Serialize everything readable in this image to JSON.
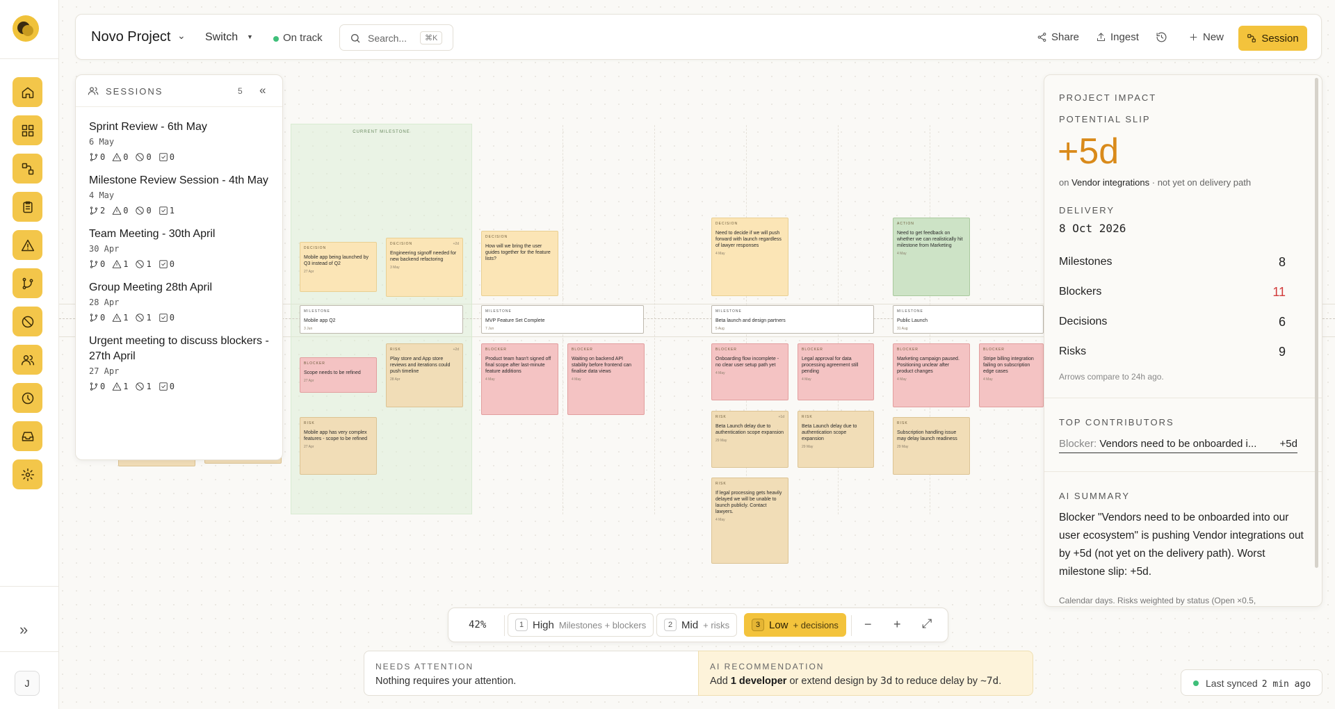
{
  "topbar": {
    "project_name": "Novo Project",
    "switch_label": "Switch",
    "status": "On track",
    "search_placeholder": "Search...",
    "search_shortcut": "⌘K",
    "share_label": "Share",
    "ingest_label": "Ingest",
    "new_label": "New",
    "session_label": "Session"
  },
  "rail": {
    "items": [
      "home",
      "dashboard",
      "workflow",
      "tasks",
      "alerts",
      "branches",
      "blocked",
      "people",
      "history",
      "inbox",
      "settings"
    ],
    "avatar_initial": "J"
  },
  "sessions": {
    "title": "SESSIONS",
    "count": "5",
    "items": [
      {
        "name": "Sprint Review - 6th May",
        "date": "6 May",
        "branches": "0",
        "risks": "0",
        "blockers": "0",
        "decisions": "0"
      },
      {
        "name": "Milestone Review Session - 4th May",
        "date": "4 May",
        "branches": "2",
        "risks": "0",
        "blockers": "0",
        "decisions": "1"
      },
      {
        "name": "Team Meeting - 30th April",
        "date": "30 Apr",
        "branches": "0",
        "risks": "1",
        "blockers": "1",
        "decisions": "0"
      },
      {
        "name": "Group Meeting 28th April",
        "date": "28 Apr",
        "branches": "0",
        "risks": "1",
        "blockers": "1",
        "decisions": "0"
      },
      {
        "name": "Urgent meeting to discuss blockers - 27th April",
        "date": "27 Apr",
        "branches": "0",
        "risks": "1",
        "blockers": "1",
        "decisions": "0"
      }
    ]
  },
  "canvas": {
    "current_milestone_label": "CURRENT MILESTONE",
    "cards": [
      {
        "type": "decision",
        "tag": "DECISION",
        "text": "Mobile app being launched by Q3 instead of Q2",
        "date": "27 Apr",
        "delta": ""
      },
      {
        "type": "decision",
        "tag": "DECISION",
        "text": "Engineering signoff needed for new backend refactoring",
        "date": "3 May",
        "delta": "+2d"
      },
      {
        "type": "milestone",
        "tag": "MILESTONE",
        "text": "Mobile app Q2",
        "date": "3 Jun",
        "delta": ""
      },
      {
        "type": "blocker",
        "tag": "BLOCKER",
        "text": "Scope needs to be refined",
        "date": "27 Apr",
        "delta": ""
      },
      {
        "type": "risk",
        "tag": "RISK",
        "text": "Play store and App store reviews and iterations could push timeline",
        "date": "28 Apr",
        "delta": "+2d"
      },
      {
        "type": "risk",
        "tag": "RISK",
        "text": "Mobile app has very complex features - scope to be refined",
        "date": "27 Apr",
        "delta": ""
      },
      {
        "type": "decision",
        "tag": "DECISION",
        "text": "How will we bring the user guides together for the feature lists?",
        "date": "",
        "delta": ""
      },
      {
        "type": "milestone",
        "tag": "MILESTONE",
        "text": "MVP Feature Set Complete",
        "date": "7 Jun",
        "delta": ""
      },
      {
        "type": "blocker",
        "tag": "BLOCKER",
        "text": "Product team hasn't signed off final scope after last-minute feature additions",
        "date": "4 May",
        "delta": ""
      },
      {
        "type": "blocker",
        "tag": "BLOCKER",
        "text": "Waiting on backend API stability before frontend can finalise data views",
        "date": "4 May",
        "delta": ""
      },
      {
        "type": "decision",
        "tag": "DECISION",
        "text": "Need to decide if we will push forward with launch regardless of lawyer responses",
        "date": "4 May",
        "delta": ""
      },
      {
        "type": "milestone",
        "tag": "MILESTONE",
        "text": "Beta launch and design partners",
        "date": "5 Aug",
        "delta": ""
      },
      {
        "type": "blocker",
        "tag": "BLOCKER",
        "text": "Onboarding flow incomplete - no clear user setup path yet",
        "date": "4 May",
        "delta": ""
      },
      {
        "type": "blocker",
        "tag": "BLOCKER",
        "text": "Legal approval for data processing agreement still pending",
        "date": "4 May",
        "delta": ""
      },
      {
        "type": "risk",
        "tag": "RISK",
        "text": "Beta Launch delay due to authentication scope expansion",
        "date": "29 May",
        "delta": "+1d"
      },
      {
        "type": "risk",
        "tag": "RISK",
        "text": "Beta Launch delay due to authentication scope expansion",
        "date": "29 May",
        "delta": ""
      },
      {
        "type": "risk",
        "tag": "RISK",
        "text": "If legal processing gets heavily delayed we will be unable to launch publicly. Contact lawyers.",
        "date": "4 May",
        "delta": ""
      },
      {
        "type": "action",
        "tag": "ACTION",
        "text": "Need to get feedback on whether we can realistically hit milestone from Marketing",
        "date": "4 May",
        "delta": ""
      },
      {
        "type": "milestone",
        "tag": "MILESTONE",
        "text": "Public Launch",
        "date": "31 Aug",
        "delta": ""
      },
      {
        "type": "blocker",
        "tag": "BLOCKER",
        "text": "Marketing campaign paused. Positioning unclear after product changes",
        "date": "4 May",
        "delta": ""
      },
      {
        "type": "blocker",
        "tag": "BLOCKER",
        "text": "Stripe billing integration failing on subscription edge cases",
        "date": "4 May",
        "delta": ""
      },
      {
        "type": "risk",
        "tag": "RISK",
        "text": "Subscription handling issue may delay launch readiness",
        "date": "29 May",
        "delta": ""
      }
    ]
  },
  "impact": {
    "title": "PROJECT IMPACT",
    "slip_caption": "POTENTIAL SLIP",
    "slip_value": "+5d",
    "on_prefix": "on",
    "on_target": "Vendor integrations",
    "on_suffix": "· not yet on delivery path",
    "delivery_caption": "DELIVERY",
    "delivery_date": "8 Oct 2026",
    "stats": [
      {
        "label": "Milestones",
        "value": "8",
        "color": "#222222"
      },
      {
        "label": "Blockers",
        "value": "11",
        "color": "#d23b3b"
      },
      {
        "label": "Decisions",
        "value": "6",
        "color": "#222222"
      },
      {
        "label": "Risks",
        "value": "9",
        "color": "#222222"
      }
    ],
    "compare_note": "Arrows compare to 24h ago.",
    "contributors_caption": "TOP CONTRIBUTORS",
    "contributor_type": "Blocker:",
    "contributor_name": "Vendors need to be onboarded i...",
    "contributor_value": "+5d",
    "ai_caption": "AI SUMMARY",
    "ai_summary": "Blocker \"Vendors need to be onboarded into our user ecosystem\" is pushing Vendor integrations out by +5d (not yet on the delivery path). Worst milestone slip: +5d.",
    "ai_footnote": "Calendar days. Risks weighted by status (Open ×0.5,"
  },
  "zoom": {
    "percent": "42%",
    "levels": [
      {
        "num": "1",
        "label": "High",
        "sub": "Milestones + blockers",
        "active": false
      },
      {
        "num": "2",
        "label": "Mid",
        "sub": "+ risks",
        "active": false
      },
      {
        "num": "3",
        "label": "Low",
        "sub": "+ decisions",
        "active": true
      }
    ]
  },
  "bottom": {
    "attention_caption": "NEEDS ATTENTION",
    "attention_text": "Nothing requires your attention.",
    "recommend_caption": "AI RECOMMENDATION",
    "rec_1": "Add ",
    "rec_2": "1 developer",
    "rec_3": " or extend design by ",
    "rec_4": "3d",
    "rec_5": " to reduce delay by ",
    "rec_6": "~7d",
    "rec_7": ".",
    "synced_label": "Last synced",
    "synced_time": "2 min ago"
  },
  "colors": {
    "accent": "#f3c33c",
    "slip": "#d98a1a",
    "blocker": "#f4c3c3",
    "risk": "#f1ddb7",
    "decision": "#fbe5b6",
    "action": "#cde3c6",
    "on_track": "#3fbf7a"
  }
}
